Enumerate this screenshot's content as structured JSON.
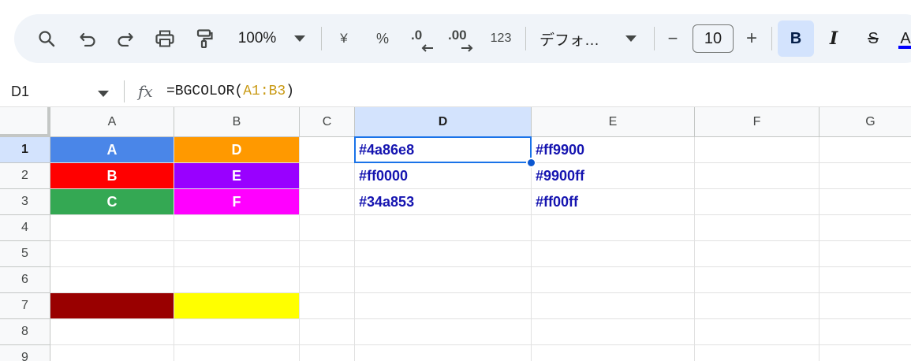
{
  "toolbar": {
    "zoom": "100%",
    "currency": "¥",
    "percent": "%",
    "decrease_decimal": ".0",
    "increase_decimal": ".00",
    "number_format": "123",
    "font": "デフォ…",
    "minus": "−",
    "font_size": "10",
    "plus": "+",
    "bold": "B",
    "italic": "I",
    "strike": "S",
    "text_color": "A",
    "text_color_value": "#0000ff"
  },
  "formula_bar": {
    "name_box": "D1",
    "fx": "fx",
    "formula_prefix": "=BGCOLOR(",
    "formula_ref": "A1:B3",
    "formula_suffix": ")"
  },
  "columns": [
    "A",
    "B",
    "C",
    "D",
    "E",
    "F",
    "G"
  ],
  "rows": [
    "1",
    "2",
    "3",
    "4",
    "5",
    "6",
    "7",
    "8",
    "9"
  ],
  "selected": {
    "column": "D",
    "row": "1",
    "cell": "D1"
  },
  "cells": {
    "A1": "A",
    "B1": "D",
    "D1": "#4a86e8",
    "E1": "#ff9900",
    "A2": "B",
    "B2": "E",
    "D2": "#ff0000",
    "E2": "#9900ff",
    "A3": "C",
    "B3": "F",
    "D3": "#34a853",
    "E3": "#ff00ff"
  },
  "cell_colors": {
    "A1": "#4a86e8",
    "B1": "#ff9900",
    "A2": "#ff0000",
    "B2": "#9900ff",
    "A3": "#34a853",
    "B3": "#ff00ff",
    "A7": "#990000",
    "B7": "#ffff00"
  }
}
